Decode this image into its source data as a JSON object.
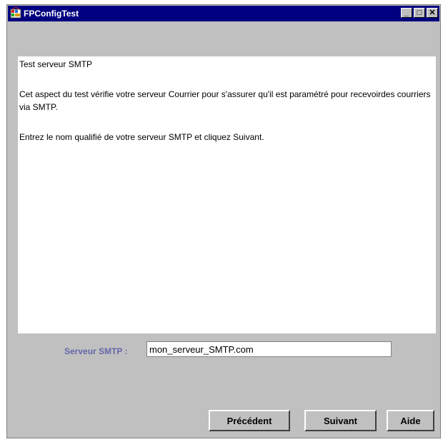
{
  "window": {
    "title": "FPConfigTest",
    "controls": {
      "minimize": "_",
      "maximize": "□",
      "close": "✕"
    }
  },
  "content": {
    "heading": "Test serveur SMTP",
    "description": "Cet aspect du test vérifie votre serveur Courrier pour s'assurer qu'il est paramétré pour recevoirdes courriers via SMTP.",
    "instruction": " Entrez le nom qualifié de votre serveur SMTP et cliquez Suivant."
  },
  "form": {
    "smtp_label": "Serveur SMTP :",
    "smtp_value": "mon_serveur_SMTP.com"
  },
  "buttons": {
    "previous": "Précédent",
    "next": "Suivant",
    "help": "Aide"
  },
  "colors": {
    "titlebar": "#000080",
    "window_bg": "#c0c0c0",
    "label_text": "#6666aa"
  }
}
